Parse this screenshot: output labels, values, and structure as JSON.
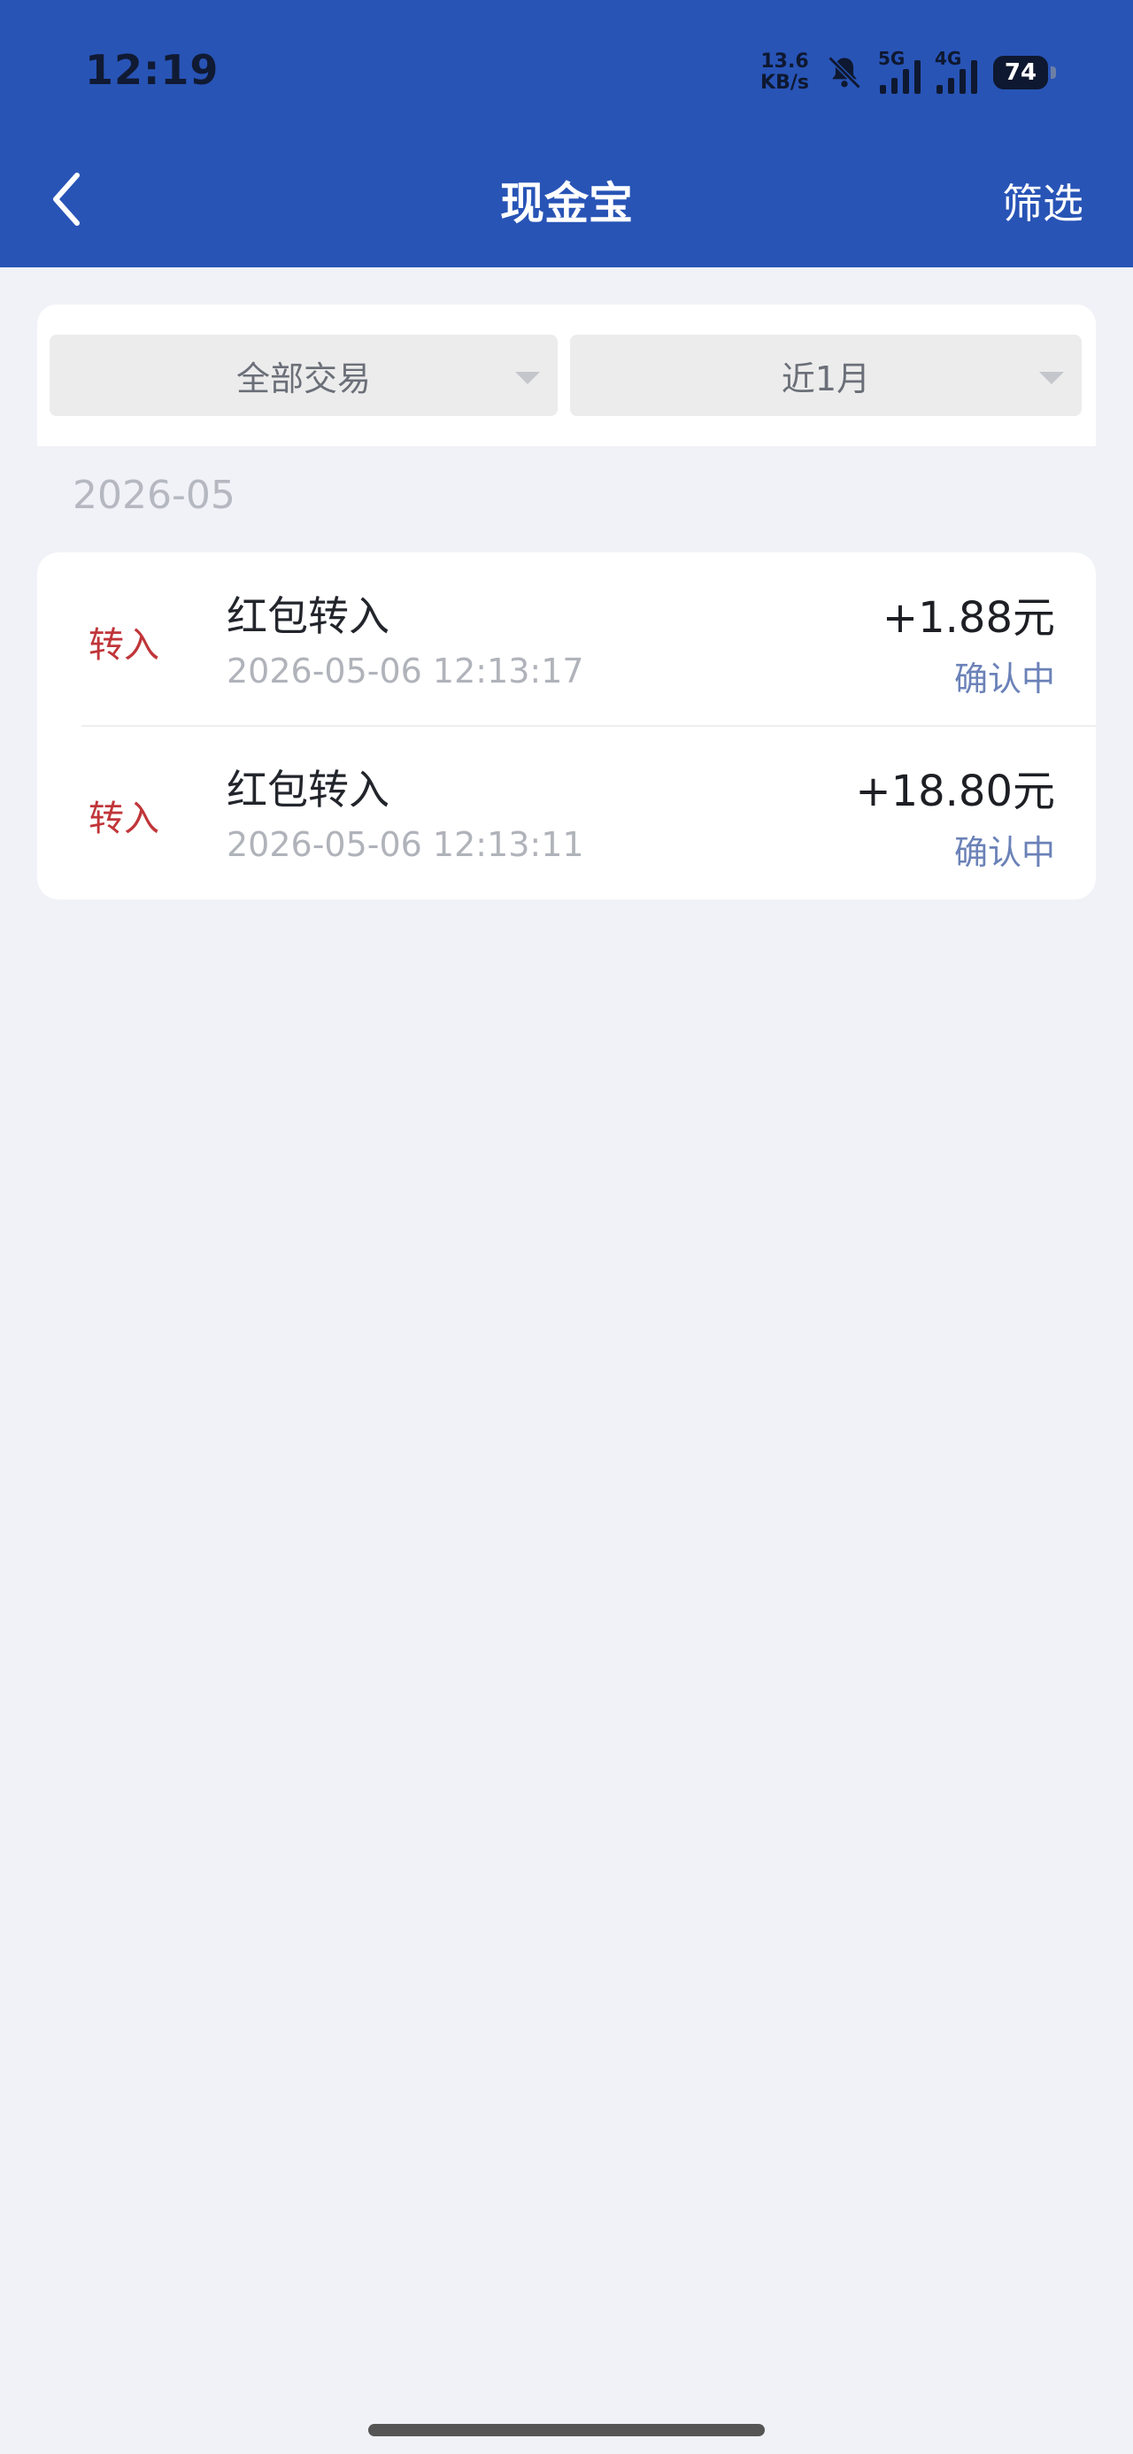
{
  "status_bar": {
    "time": "12:19",
    "net_speed_value": "13.6",
    "net_speed_unit": "KB/s",
    "sim1_label": "5G",
    "sim2_label": "4G",
    "battery": "74"
  },
  "header": {
    "title": "现金宝",
    "filter_label": "筛选",
    "back_icon": "chevron-left-icon"
  },
  "filters": {
    "type_label": "全部交易",
    "period_label": "近1月"
  },
  "month_label": "2026-05",
  "transactions": [
    {
      "type": "转入",
      "name": "红包转入",
      "time": "2026-05-06 12:13:17",
      "amount": "+1.88元",
      "status": "确认中"
    },
    {
      "type": "转入",
      "name": "红包转入",
      "time": "2026-05-06 12:13:11",
      "amount": "+18.80元",
      "status": "确认中"
    }
  ],
  "colors": {
    "header_bg": "#2854b6",
    "type_red": "#c0363a",
    "status_blue": "#6b82b8",
    "page_bg": "#f0f2f7"
  }
}
